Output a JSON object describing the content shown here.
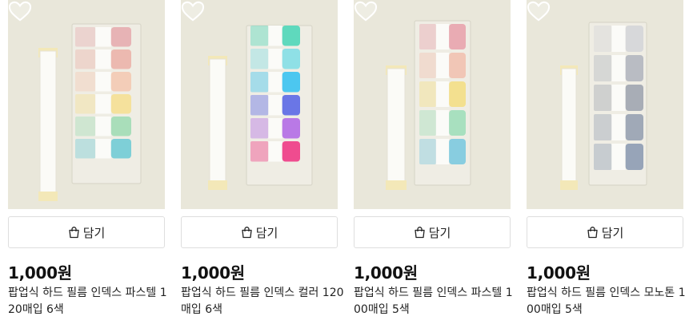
{
  "products": [
    {
      "cart_label": "담기",
      "price": "1,000원",
      "name": "팝업식 하드 필름 인덱스 파스텔 120매입 6색",
      "image": {
        "tab_count": 6,
        "colors": [
          "#e7b3b5",
          "#ecb9b0",
          "#f3cdb8",
          "#f5e19c",
          "#a9deba",
          "#7ecfd7"
        ]
      }
    },
    {
      "cart_label": "담기",
      "price": "1,000원",
      "name": "팝업식 하드 필름 인덱스 컬러 120매입 6색",
      "image": {
        "tab_count": 6,
        "colors": [
          "#5fd9bd",
          "#8fe0e6",
          "#4cc7f0",
          "#6a76e6",
          "#b979e6",
          "#ef4c8f"
        ]
      }
    },
    {
      "cart_label": "담기",
      "price": "1,000원",
      "name": "팝업식 하드 필름 인덱스 파스텔 100매입 5색",
      "image": {
        "tab_count": 5,
        "colors": [
          "#e9abb3",
          "#f1c6b6",
          "#f3e08f",
          "#a8e0bf",
          "#88cde0"
        ]
      }
    },
    {
      "cart_label": "담기",
      "price": "1,000원",
      "name": "팝업식 하드 필름 인덱스 모노톤 100매입 5색",
      "image": {
        "tab_count": 5,
        "colors": [
          "#d7d8da",
          "#b9bcc3",
          "#a8adb6",
          "#a0a9b7",
          "#97a4b8"
        ]
      }
    }
  ]
}
